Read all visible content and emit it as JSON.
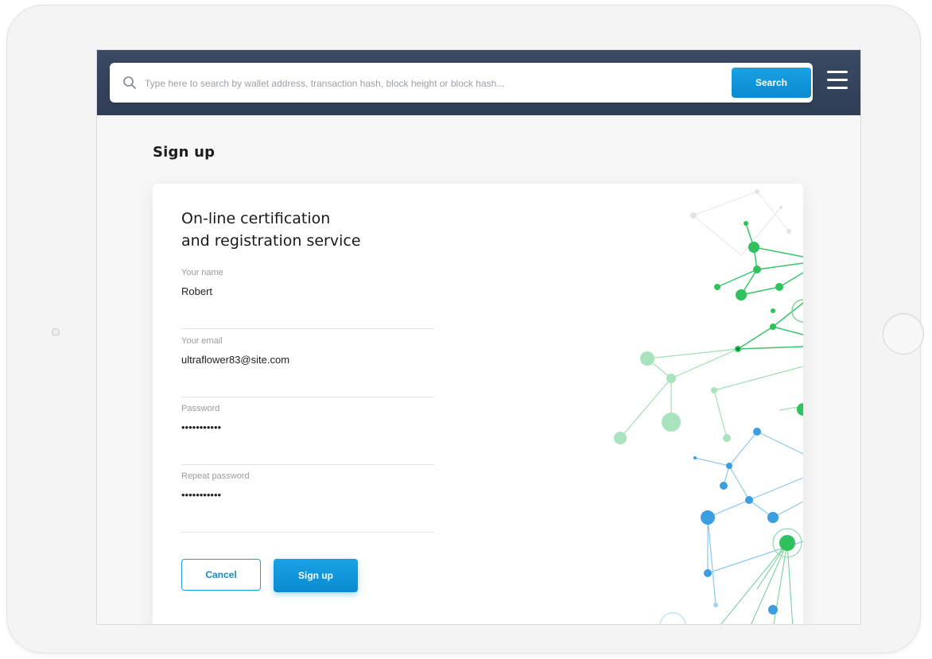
{
  "search": {
    "placeholder": "Type here to search by wallet address, transaction hash, block height or block hash...",
    "button_label": "Search"
  },
  "page": {
    "title": "Sign up"
  },
  "card": {
    "title_line1": "On-line certification",
    "title_line2": "and registration service"
  },
  "form": {
    "fields": [
      {
        "label": "Your name",
        "value": "Robert"
      },
      {
        "label": "Your email",
        "value": "ultraflower83@site.com"
      },
      {
        "label": "Password",
        "value": "•••••••••••"
      },
      {
        "label": "Repeat password",
        "value": "•••••••••••"
      }
    ],
    "cancel_label": "Cancel",
    "submit_label": "Sign up"
  },
  "colors": {
    "topbar": "#2f3d55",
    "accent": "#0b8bd1",
    "network_green": "#22c35e",
    "network_blue": "#3aa0e0"
  },
  "icons": {
    "search": "search-icon",
    "menu": "hamburger-menu-icon",
    "decoration": "network-graph-illustration"
  }
}
